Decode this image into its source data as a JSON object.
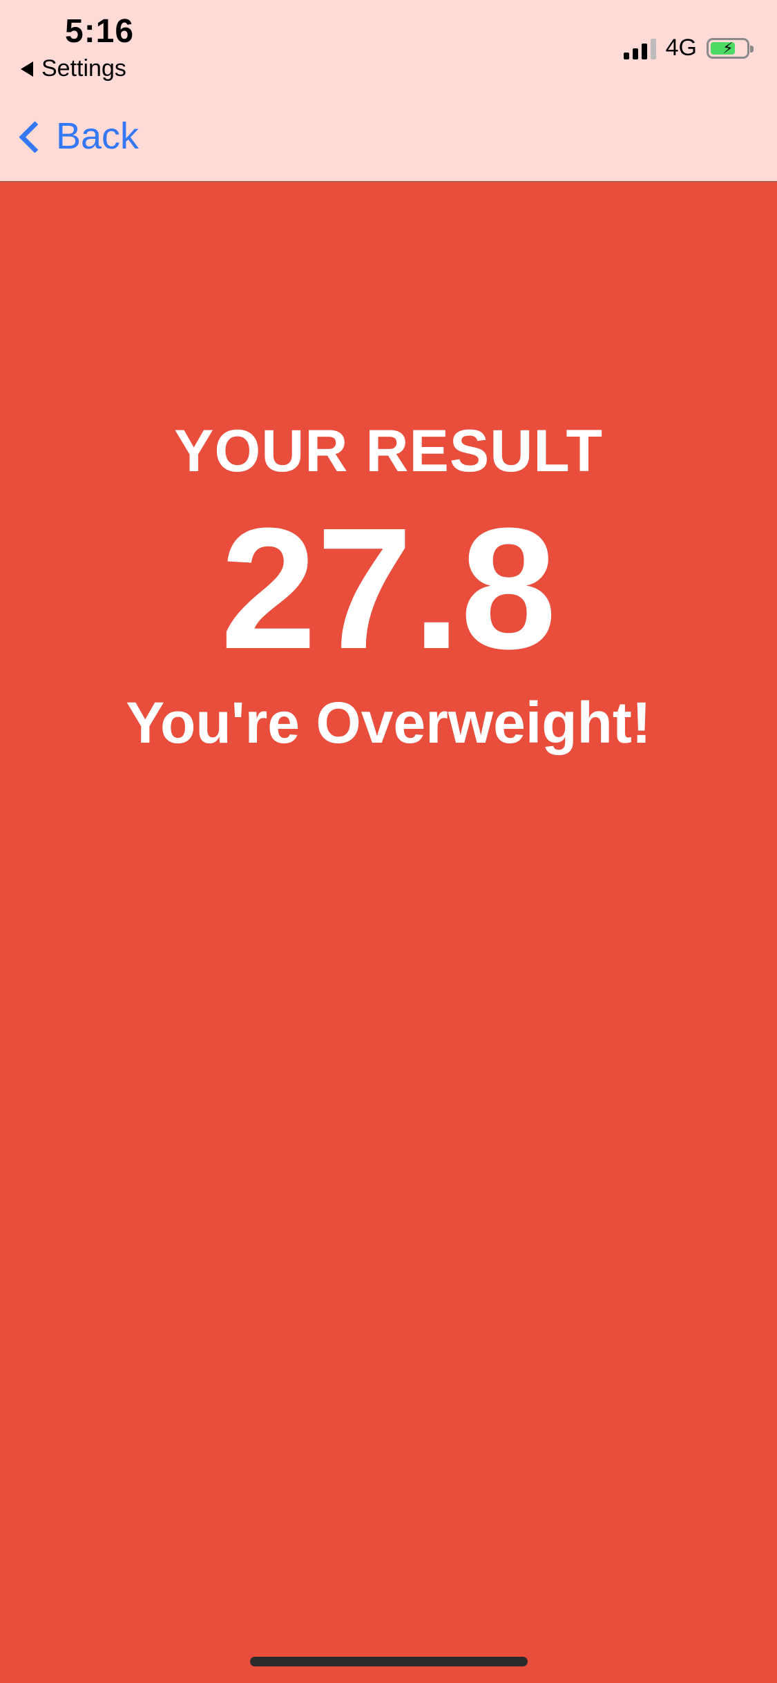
{
  "status_bar": {
    "time": "5:16",
    "back_app_label": "Settings",
    "network": "4G"
  },
  "nav": {
    "back_label": "Back"
  },
  "result": {
    "title": "YOUR RESULT",
    "value": "27.8",
    "message": "You're Overweight!"
  },
  "colors": {
    "background": "#E94E3D",
    "header": "#FFDBD8",
    "accent": "#3478F6",
    "battery": "#4CD964"
  },
  "battery_level": 0.7
}
